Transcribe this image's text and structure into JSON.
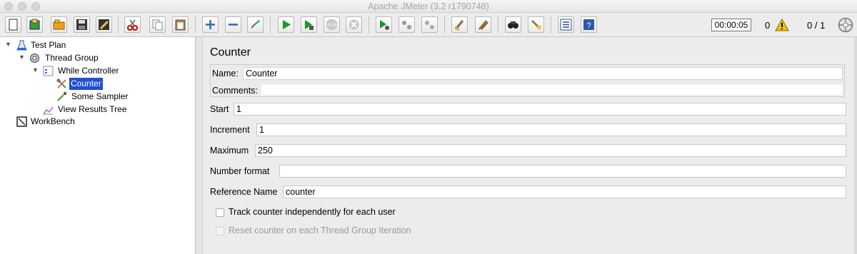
{
  "window": {
    "title": "Apache JMeter (3.2 r1790748)"
  },
  "toolbar": {
    "buttons": [
      "new-icon",
      "templates-icon",
      "open-icon",
      "save-icon",
      "save-as-icon",
      "cut-icon",
      "copy-icon",
      "paste-icon",
      "expand-icon",
      "collapse-icon",
      "toggle-icon",
      "start-icon",
      "start-no-pauses-icon",
      "stop-icon",
      "shutdown-icon",
      "remote-start-icon",
      "remote-stop-icon",
      "remote-exit-icon",
      "clear-icon",
      "clear-all-icon",
      "search-icon",
      "reset-search-icon",
      "function-helper-icon",
      "help-icon"
    ],
    "timer": "00:00:05",
    "warning_count": "0",
    "threads": "0 / 1"
  },
  "tree": {
    "nodes": [
      {
        "label": "Test Plan",
        "icon": "flask-icon"
      },
      {
        "label": "Thread Group",
        "icon": "gear-icon"
      },
      {
        "label": "While Controller",
        "icon": "controller-icon"
      },
      {
        "label": "Counter",
        "icon": "tools-icon",
        "selected": true
      },
      {
        "label": "Some Sampler",
        "icon": "pipette-icon"
      },
      {
        "label": "View Results Tree",
        "icon": "chart-icon"
      },
      {
        "label": "WorkBench",
        "icon": "workbench-icon"
      }
    ]
  },
  "panel": {
    "title": "Counter",
    "name_label": "Name:",
    "name_value": "Counter",
    "comments_label": "Comments:",
    "comments_value": "",
    "start_label": "Start",
    "start_value": "1",
    "increment_label": "Increment",
    "increment_value": "1",
    "maximum_label": "Maximum",
    "maximum_value": "250",
    "number_format_label": "Number format",
    "number_format_value": "",
    "reference_name_label": "Reference Name",
    "reference_name_value": "counter",
    "track_label": "Track counter independently for each user",
    "track_checked": false,
    "reset_label": "Reset counter on each Thread Group Iteration",
    "reset_checked": false,
    "reset_enabled": false
  },
  "colors": {
    "selection": "#1f4fd3",
    "start_green": "#1a9a2a",
    "warning_yellow": "#f3c400"
  }
}
